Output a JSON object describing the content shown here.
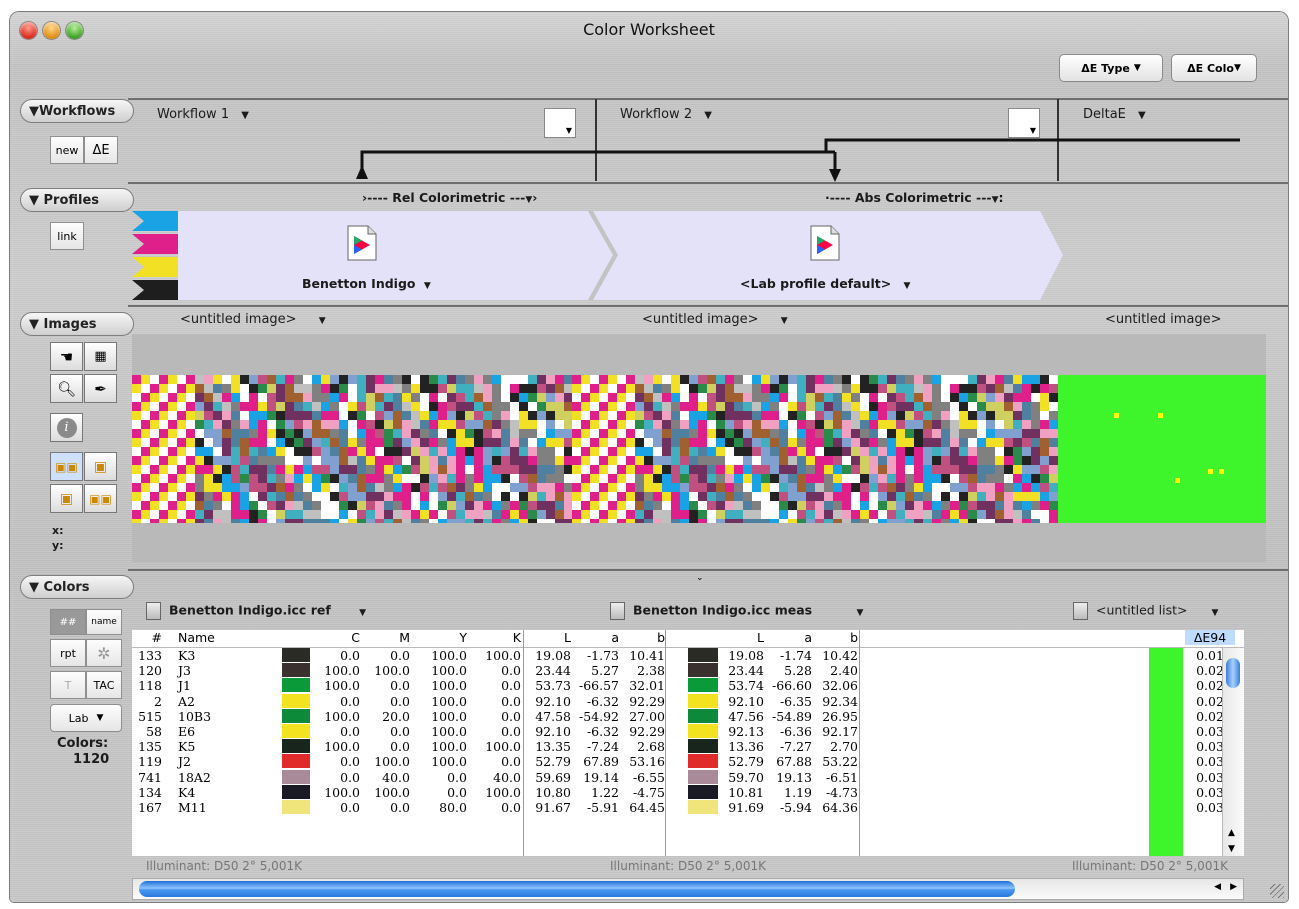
{
  "window": {
    "title": "Color Worksheet"
  },
  "toolbar": {
    "de_type": "ΔE Type",
    "de_color": "ΔE Colo"
  },
  "sections": {
    "workflows": "Workflows",
    "profiles": "Profiles",
    "images": "Images",
    "colors": "Colors"
  },
  "workflows": {
    "new": "new",
    "de": "ΔE",
    "wf1": "Workflow 1",
    "wf2": "Workflow 2",
    "deltae": "DeltaE"
  },
  "profiles": {
    "link": "link",
    "intent1": "›---- Rel Colorimetric ---",
    "intent2": "·---- Abs Colorimetric ---",
    "profile1": "Benetton Indigo",
    "profile2": "<Lab profile default>"
  },
  "images": {
    "img1": "<untitled image>",
    "img2": "<untitled image>",
    "img3": "<untitled image>",
    "x_label": "x:",
    "y_label": "y:"
  },
  "colors_panel": {
    "hash": "##",
    "name": "name",
    "rpt": "rpt",
    "t": "T",
    "tac": "TAC",
    "lab": "Lab",
    "count_label": "Colors:",
    "count": "1120"
  },
  "lists": {
    "ref": "Benetton Indigo.icc ref",
    "meas": "Benetton Indigo.icc meas",
    "untitled": "<untitled list>",
    "illum1": "Illuminant: D50 2° 5,001K",
    "illum2": "Illuminant: D50 2° 5,001K",
    "illum3": "Illuminant: D50 2° 5,001K"
  },
  "table": {
    "headers": {
      "num": "#",
      "name": "Name",
      "c": "C",
      "m": "M",
      "y": "Y",
      "k": "K",
      "l": "L",
      "a": "a",
      "b": "b",
      "l2": "L",
      "a2": "a",
      "b2": "b",
      "de": "ΔE94"
    },
    "rows": [
      {
        "num": "133",
        "name": "K3",
        "swatch": "#2b2b26",
        "c": "0.0",
        "m": "0.0",
        "y": "100.0",
        "k": "100.0",
        "l": "19.08",
        "a": "-1.73",
        "b": "10.41",
        "l2": "19.08",
        "a2": "-1.74",
        "b2": "10.42",
        "de": "0.01"
      },
      {
        "num": "120",
        "name": "J3",
        "swatch": "#3a302e",
        "c": "100.0",
        "m": "100.0",
        "y": "100.0",
        "k": "0.0",
        "l": "23.44",
        "a": "5.27",
        "b": "2.38",
        "l2": "23.44",
        "a2": "5.28",
        "b2": "2.40",
        "de": "0.02"
      },
      {
        "num": "118",
        "name": "J1",
        "swatch": "#0a9a3a",
        "c": "100.0",
        "m": "0.0",
        "y": "100.0",
        "k": "0.0",
        "l": "53.73",
        "a": "-66.57",
        "b": "32.01",
        "l2": "53.74",
        "a2": "-66.60",
        "b2": "32.06",
        "de": "0.02"
      },
      {
        "num": "2",
        "name": "A2",
        "swatch": "#f3e21f",
        "c": "0.0",
        "m": "0.0",
        "y": "100.0",
        "k": "0.0",
        "l": "92.10",
        "a": "-6.32",
        "b": "92.29",
        "l2": "92.10",
        "a2": "-6.35",
        "b2": "92.34",
        "de": "0.02"
      },
      {
        "num": "515",
        "name": "10B3",
        "swatch": "#0c8a3a",
        "c": "100.0",
        "m": "20.0",
        "y": "100.0",
        "k": "0.0",
        "l": "47.58",
        "a": "-54.92",
        "b": "27.00",
        "l2": "47.56",
        "a2": "-54.89",
        "b2": "26.95",
        "de": "0.02"
      },
      {
        "num": "58",
        "name": "E6",
        "swatch": "#f3e21f",
        "c": "0.0",
        "m": "0.0",
        "y": "100.0",
        "k": "0.0",
        "l": "92.10",
        "a": "-6.32",
        "b": "92.29",
        "l2": "92.13",
        "a2": "-6.36",
        "b2": "92.17",
        "de": "0.03"
      },
      {
        "num": "135",
        "name": "K5",
        "swatch": "#18251c",
        "c": "100.0",
        "m": "0.0",
        "y": "100.0",
        "k": "100.0",
        "l": "13.35",
        "a": "-7.24",
        "b": "2.68",
        "l2": "13.36",
        "a2": "-7.27",
        "b2": "2.70",
        "de": "0.03"
      },
      {
        "num": "119",
        "name": "J2",
        "swatch": "#e12a2a",
        "c": "0.0",
        "m": "100.0",
        "y": "100.0",
        "k": "0.0",
        "l": "52.79",
        "a": "67.89",
        "b": "53.16",
        "l2": "52.79",
        "a2": "67.88",
        "b2": "53.22",
        "de": "0.03"
      },
      {
        "num": "741",
        "name": "18A2",
        "swatch": "#a88a98",
        "c": "0.0",
        "m": "40.0",
        "y": "0.0",
        "k": "40.0",
        "l": "59.69",
        "a": "19.14",
        "b": "-6.55",
        "l2": "59.70",
        "a2": "19.13",
        "b2": "-6.51",
        "de": "0.03"
      },
      {
        "num": "134",
        "name": "K4",
        "swatch": "#1a1a24",
        "c": "100.0",
        "m": "100.0",
        "y": "0.0",
        "k": "100.0",
        "l": "10.80",
        "a": "1.22",
        "b": "-4.75",
        "l2": "10.81",
        "a2": "1.19",
        "b2": "-4.73",
        "de": "0.03"
      },
      {
        "num": "167",
        "name": "M11",
        "swatch": "#efe57a",
        "c": "0.0",
        "m": "0.0",
        "y": "80.0",
        "k": "0.0",
        "l": "91.67",
        "a": "-5.91",
        "b": "64.45",
        "l2": "91.69",
        "a2": "-5.94",
        "b2": "64.36",
        "de": "0.03"
      }
    ]
  },
  "colors": {
    "de_image_bg": "#3ef52c",
    "profile_band": "#e4e2f8",
    "scroll_blue": "#3e8ee6"
  }
}
